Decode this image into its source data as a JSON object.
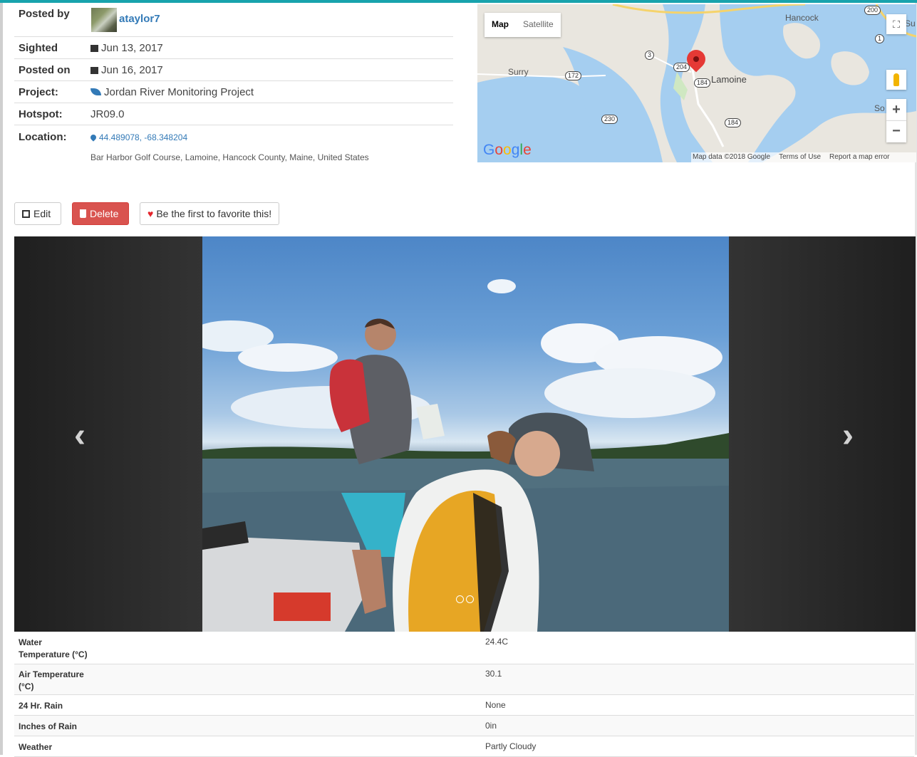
{
  "info": {
    "posted_by_label": "Posted by",
    "username": "ataylor7",
    "sighted_label": "Sighted",
    "sighted_date": "Jun 13, 2017",
    "posted_on_label": "Posted on",
    "posted_on_date": "Jun 16, 2017",
    "project_label": "Project:",
    "project_name": "Jordan River Monitoring Project",
    "hotspot_label": "Hotspot:",
    "hotspot_value": "JR09.0",
    "location_label": "Location:",
    "coordinates": "44.489078, -68.348204",
    "address": "Bar Harbor Golf Course, Lamoine, Hancock County, Maine, United States"
  },
  "map": {
    "tab_map": "Map",
    "tab_satellite": "Satellite",
    "place_hancock": "Hancock",
    "place_surry": "Surry",
    "place_lamoine": "Lamoine",
    "place_so": "So",
    "place_su": "Su",
    "route_3": "3",
    "route_172": "172",
    "route_204": "204",
    "route_184a": "184",
    "route_184b": "184",
    "route_230": "230",
    "route_200": "200",
    "route_1": "1",
    "attribution": "Map data ©2018 Google",
    "terms": "Terms of Use",
    "report": "Report a map error",
    "zoom_in": "+",
    "zoom_out": "−",
    "fullscreen": "⛶"
  },
  "actions": {
    "edit_label": "Edit",
    "delete_label": "Delete",
    "favorite_label": "Be the first to favorite this!"
  },
  "carousel": {
    "prev": "‹",
    "next": "›"
  },
  "measurements": [
    {
      "label": "Water Temperature (°C)",
      "value": "24.4C"
    },
    {
      "label": "Air Temperature (°C)",
      "value": "30.1"
    },
    {
      "label": "24 Hr. Rain",
      "value": "None"
    },
    {
      "label": "Inches of Rain",
      "value": "0in"
    },
    {
      "label": "Weather",
      "value": "Partly Cloudy"
    }
  ],
  "colors": {
    "accent": "#18a3ad",
    "link": "#337ab7",
    "danger": "#d9534f",
    "heart": "#e4242b"
  }
}
